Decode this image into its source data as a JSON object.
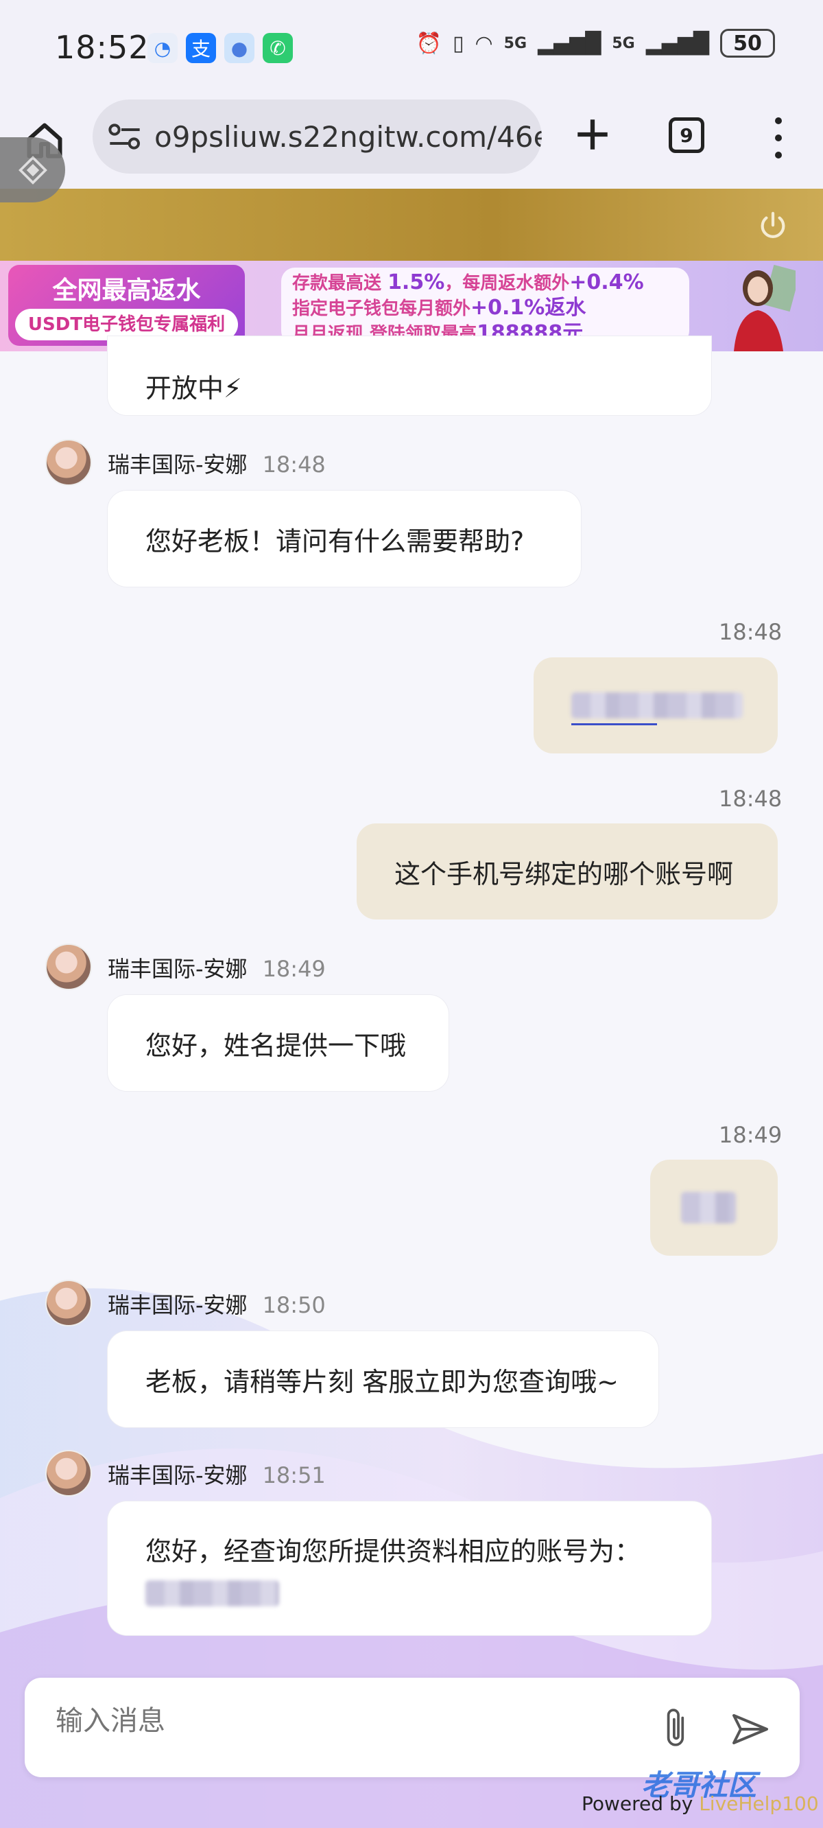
{
  "status_bar": {
    "time": "18:52",
    "battery": "50",
    "network_1": "5G",
    "network_2": "5G"
  },
  "browser": {
    "url": "o9psliuw.s22ngitw.com/46e",
    "tab_count": "9"
  },
  "promo": {
    "left_title": "全网最高返水",
    "left_sub": "USDT电子钱包专属福利",
    "line1_prefix": "存款最高送 ",
    "line1_value": "1.5%",
    "line1_mid": "，每周返水额外",
    "line1_value2": "+0.4%",
    "line2_prefix": "指定电子钱包每月额外",
    "line2_value": "+0.1%返水",
    "line3_prefix": "月月返现 登陆领取最高",
    "line3_value": "188888元"
  },
  "messages": {
    "m0_text": "开放中⚡",
    "m1_sender": "瑞丰国际-安娜",
    "m1_time": "18:48",
    "m1_text": "您好老板！请问有什么需要帮助?",
    "m2_time": "18:48",
    "m3_time": "18:48",
    "m3_text": "这个手机号绑定的哪个账号啊",
    "m4_sender": "瑞丰国际-安娜",
    "m4_time": "18:49",
    "m4_text": "您好，姓名提供一下哦",
    "m5_time": "18:49",
    "m6_sender": "瑞丰国际-安娜",
    "m6_time": "18:50",
    "m6_text": "老板，请稍等片刻 客服立即为您查询哦~",
    "m7_sender": "瑞丰国际-安娜",
    "m7_time": "18:51",
    "m7_text": "您好，经查询您所提供资料相应的账号为："
  },
  "input": {
    "placeholder": "输入消息"
  },
  "footer": {
    "powered_prefix": "Powered by ",
    "powered_brand": "LiveHelp100",
    "watermark": "老哥社区"
  },
  "colors": {
    "gold_header": "#b8922f",
    "my_bubble": "#efe8d9",
    "link_blue": "#2a6fe0"
  },
  "icons": [
    "home-icon",
    "tune-icon",
    "plus-icon",
    "tabs-icon",
    "more-vert-icon",
    "power-icon",
    "attach-icon",
    "send-icon",
    "alarm-icon",
    "vibrate-icon",
    "wifi-icon",
    "signal-icon"
  ]
}
